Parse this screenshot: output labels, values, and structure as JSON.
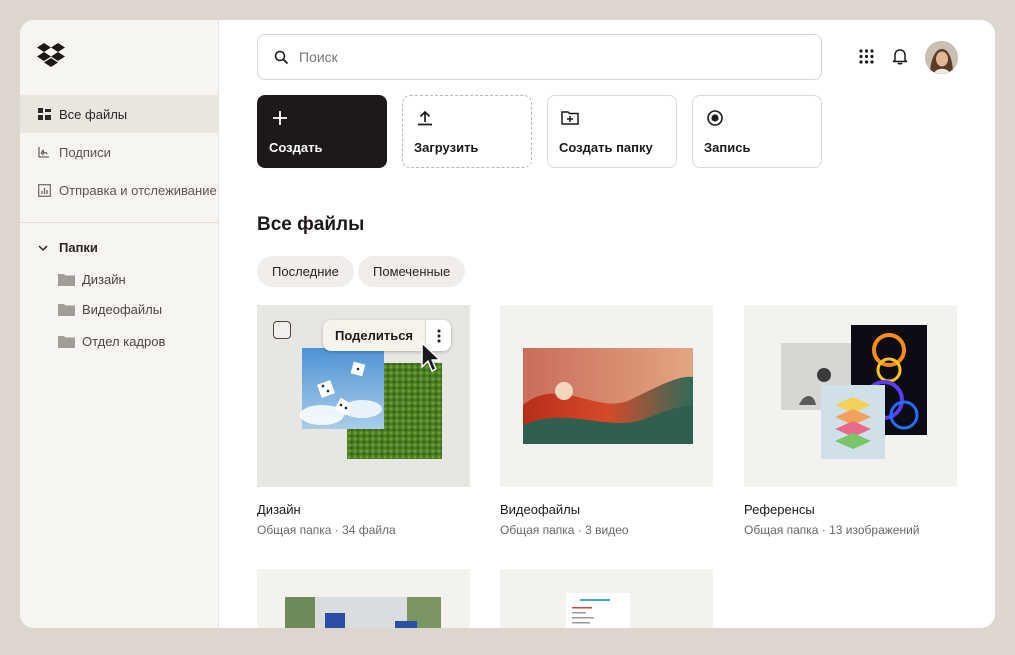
{
  "sidebar": {
    "items": [
      {
        "label": "Все файлы",
        "icon": "all-files-icon",
        "active": true
      },
      {
        "label": "Подписи",
        "icon": "signature-icon",
        "active": false
      },
      {
        "label": "Отправка и отслеживание",
        "icon": "chart-icon",
        "active": false
      }
    ],
    "folders_label": "Папки",
    "folders": [
      "Дизайн",
      "Видеофайлы",
      "Отдел кадров"
    ]
  },
  "search": {
    "placeholder": "Поиск",
    "value": ""
  },
  "actions": {
    "create": "Создать",
    "upload": "Загрузить",
    "new_folder": "Создать папку",
    "record": "Запись"
  },
  "main": {
    "title": "Все файлы",
    "chips": [
      "Последние",
      "Помеченные"
    ]
  },
  "cards": [
    {
      "name": "Дизайн",
      "meta": "Общая папка · 34 файла"
    },
    {
      "name": "Видеофайлы",
      "meta": "Общая папка · 3 видео"
    },
    {
      "name": "Референсы",
      "meta": "Общая папка · 13 изображений"
    }
  ],
  "share_label": "Поделиться",
  "colors": {
    "primary": "#1e1919",
    "sidebar_bg": "#f7f5f2",
    "page_bg": "#dcd6ce"
  }
}
